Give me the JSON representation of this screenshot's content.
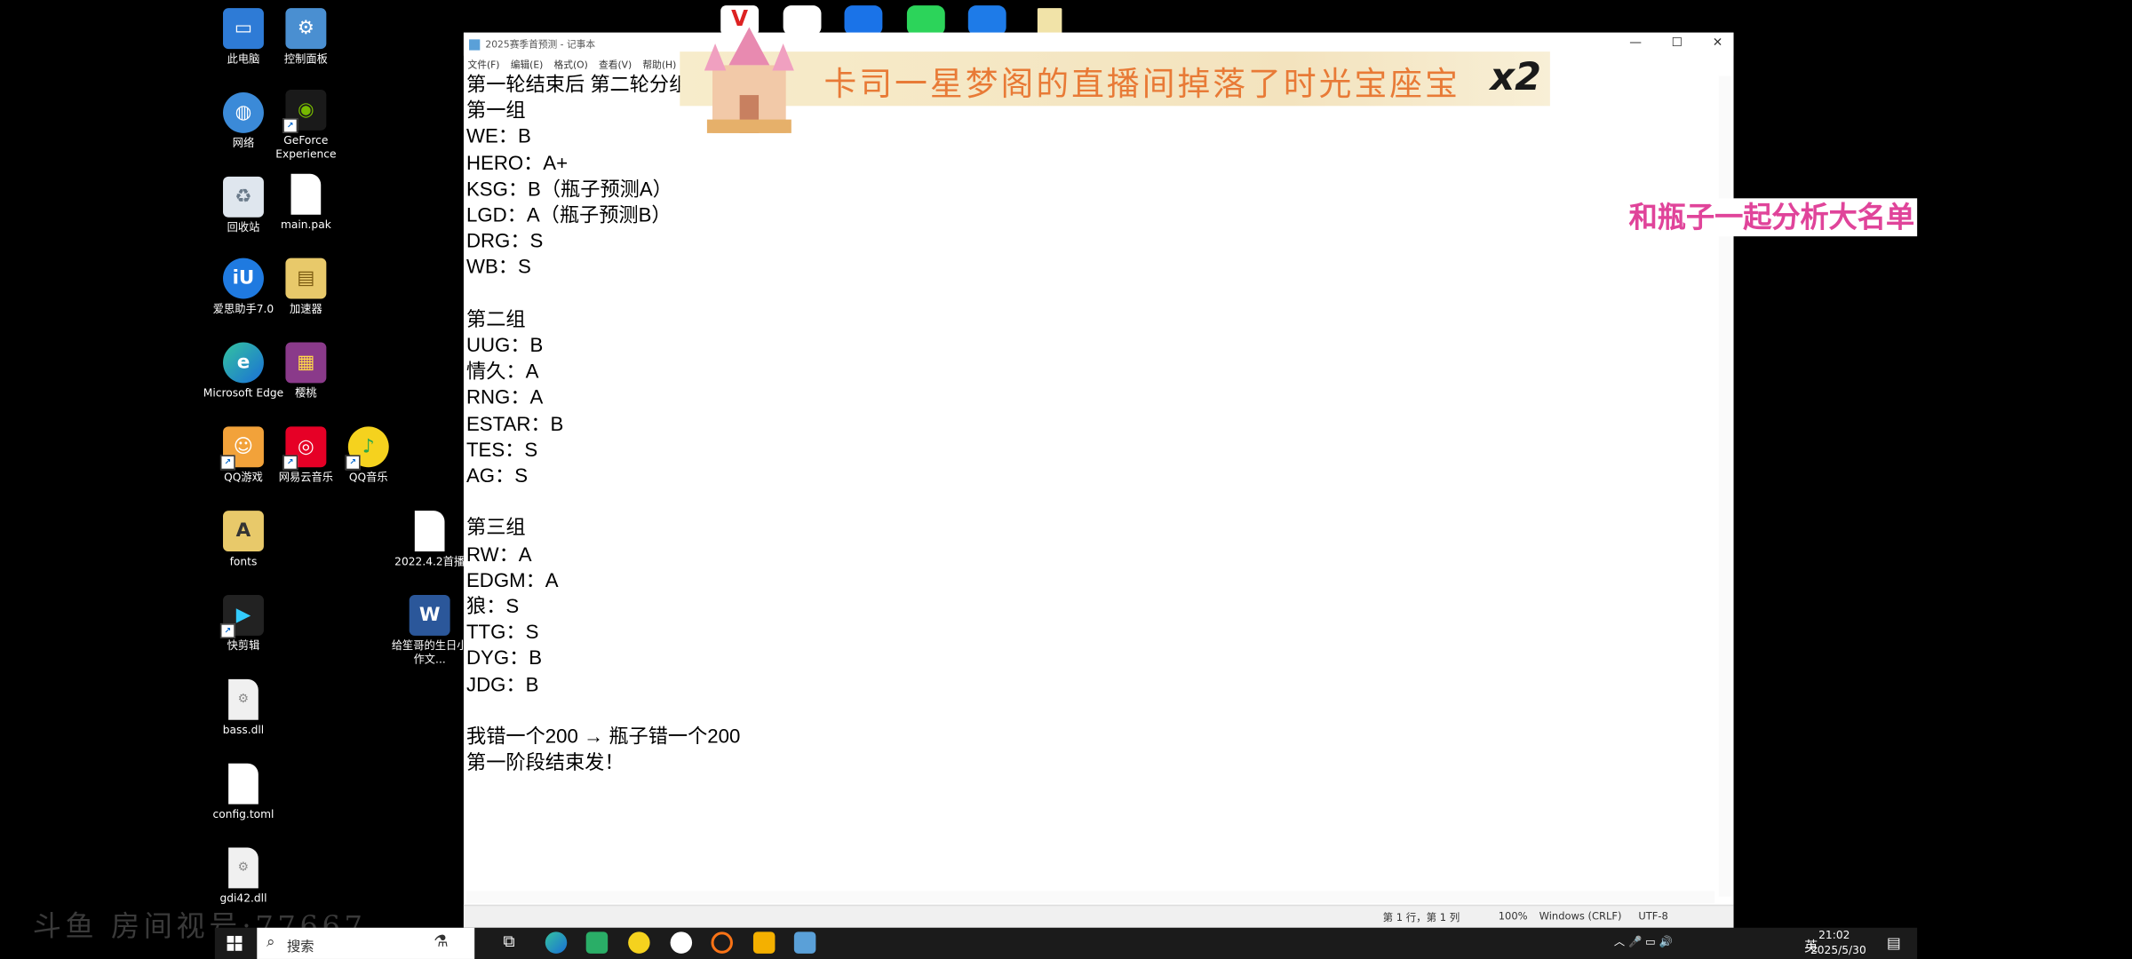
{
  "desktop": {
    "icons": [
      {
        "label": "此电脑"
      },
      {
        "label": "控制面板"
      },
      {
        "label": "网络"
      },
      {
        "label": "GeForce Experience"
      },
      {
        "label": "回收站"
      },
      {
        "label": "main.pak"
      },
      {
        "label": "爱思助手7.0"
      },
      {
        "label": "加速器"
      },
      {
        "label": "Microsoft Edge"
      },
      {
        "label": "樱桃"
      },
      {
        "label": "QQ游戏"
      },
      {
        "label": "网易云音乐"
      },
      {
        "label": "QQ音乐"
      },
      {
        "label": "fonts"
      },
      {
        "label": "2022.4.2首播"
      },
      {
        "label": "快剪辑"
      },
      {
        "label": "给笙哥的生日小作文..."
      },
      {
        "label": "bass.dll"
      },
      {
        "label": "config.toml"
      },
      {
        "label": "gdi42.dll"
      }
    ]
  },
  "notepad": {
    "title": "2025赛季首预测 - 记事本",
    "menu": [
      "文件(F)",
      "编辑(E)",
      "格式(O)",
      "查看(V)",
      "帮助(H)"
    ],
    "lines": [
      "第一轮结束后 第二轮分组",
      "第一组",
      "WE：B",
      "HERO：A+",
      "KSG：B（瓶子预测A）",
      "LGD：A（瓶子预测B）",
      "DRG：S",
      "WB：S",
      "",
      "第二组",
      "UUG：B",
      "情久：A",
      "RNG：A",
      "ESTAR：B",
      "TES：S",
      "AG：S",
      "",
      "第三组",
      "RW：A",
      "EDGM：A",
      "狼：S",
      "TTG：S",
      "DYG：B",
      "JDG：B",
      "",
      "我错一个200 → 瓶子错一个200",
      "第一阶段结束发！"
    ],
    "status": {
      "position": "第 1 行，第 1 列",
      "zoom": "100%",
      "line_ending": "Windows (CRLF)",
      "encoding": "UTF-8"
    }
  },
  "stream": {
    "gift_banner": "卡司一星梦阁的直播间掉落了时光宝座宝",
    "gift_multiplier": "x2",
    "overlay_label": "和瓶子一起分析大名单",
    "watermark": "斗鱼 房间视号:77667"
  },
  "taskbar": {
    "search_label": "搜索",
    "tray_lang": "英",
    "time": "21:02",
    "date": "2025/5/30"
  },
  "colors": {
    "overlay_text": "#e0449a",
    "banner_text": "#e87a36"
  }
}
